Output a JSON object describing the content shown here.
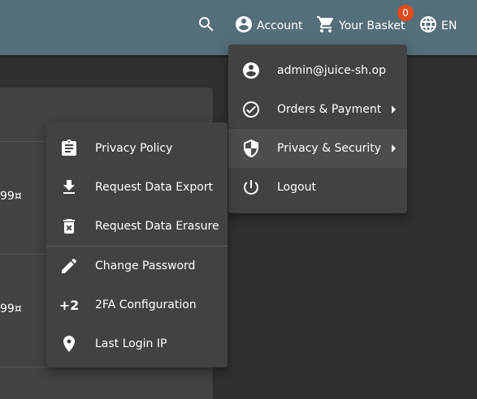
{
  "toolbar": {
    "search_icon": "search-icon",
    "account_label": "Account",
    "basket_label": "Your Basket",
    "basket_count": "0",
    "language_label": "EN",
    "colors": {
      "toolbar_bg": "#546e7a",
      "badge": "#e64a19"
    }
  },
  "card": {
    "prices": [
      "99¤",
      "99¤"
    ]
  },
  "account_menu": {
    "items": [
      {
        "label": "admin@juice-sh.op",
        "icon": "account-circle-icon"
      },
      {
        "label": "Orders & Payment",
        "icon": "check-circle-icon",
        "submenu": true
      },
      {
        "label": "Privacy & Security",
        "icon": "shield-icon",
        "submenu": true,
        "active": true
      },
      {
        "label": "Logout",
        "icon": "power-icon"
      }
    ]
  },
  "privacy_menu": {
    "items": [
      {
        "label": "Privacy Policy",
        "icon": "assignment-icon"
      },
      {
        "label": "Request Data Export",
        "icon": "download-icon"
      },
      {
        "label": "Request Data Erasure",
        "icon": "delete-forever-icon"
      },
      {
        "label": "Change Password",
        "icon": "pencil-icon"
      },
      {
        "label": "2FA Configuration",
        "icon": "plus-two-icon",
        "icon_text": "+2"
      },
      {
        "label": "Last Login IP",
        "icon": "location-pin-icon"
      }
    ]
  }
}
